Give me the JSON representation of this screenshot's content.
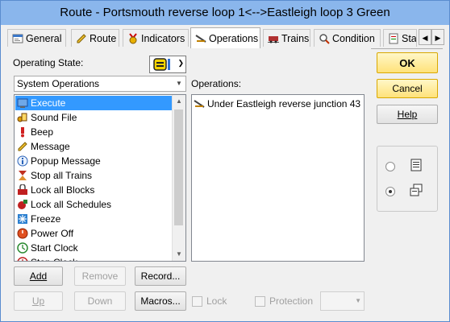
{
  "window": {
    "title": "Route - Portsmouth reverse loop 1<-->Eastleigh loop 3 Green"
  },
  "tabs": [
    {
      "label": "General",
      "icon": "general-icon"
    },
    {
      "label": "Route",
      "icon": "route-pencil-icon"
    },
    {
      "label": "Indicators",
      "icon": "indicators-icon"
    },
    {
      "label": "Operations",
      "icon": "operations-icon",
      "active": true
    },
    {
      "label": "Trains",
      "icon": "trains-icon"
    },
    {
      "label": "Condition",
      "icon": "condition-icon"
    },
    {
      "label": "Sta",
      "icon": "stats-icon"
    }
  ],
  "left": {
    "operating_state_label": "Operating State:",
    "category": "System Operations",
    "items": [
      {
        "label": "Execute",
        "icon": "execute-icon",
        "selected": true
      },
      {
        "label": "Sound File",
        "icon": "sound-file-icon"
      },
      {
        "label": "Beep",
        "icon": "beep-icon"
      },
      {
        "label": "Message",
        "icon": "message-icon"
      },
      {
        "label": "Popup Message",
        "icon": "popup-message-icon"
      },
      {
        "label": "Stop all Trains",
        "icon": "stop-trains-icon"
      },
      {
        "label": "Lock all Blocks",
        "icon": "lock-blocks-icon"
      },
      {
        "label": "Lock all Schedules",
        "icon": "lock-schedules-icon"
      },
      {
        "label": "Freeze",
        "icon": "freeze-icon"
      },
      {
        "label": "Power Off",
        "icon": "power-off-icon"
      },
      {
        "label": "Start Clock",
        "icon": "start-clock-icon"
      },
      {
        "label": "Stop Clock",
        "icon": "stop-clock-icon"
      }
    ]
  },
  "operations": {
    "label": "Operations:",
    "items": [
      {
        "label": "Under Eastleigh reverse junction 43",
        "icon": "junction-operation-icon"
      }
    ]
  },
  "buttons": {
    "add": "Add",
    "remove": "Remove",
    "record": "Record...",
    "up": "Up",
    "down": "Down",
    "macros": "Macros...",
    "ok": "OK",
    "cancel": "Cancel",
    "help": "Help"
  },
  "checks": {
    "lock": "Lock",
    "protection": "Protection"
  },
  "view": {
    "selected": "icons"
  },
  "colors": {
    "selection": "#3399ff",
    "ok_button": "#ffe27a",
    "titlebar": "#8ab6ec"
  }
}
